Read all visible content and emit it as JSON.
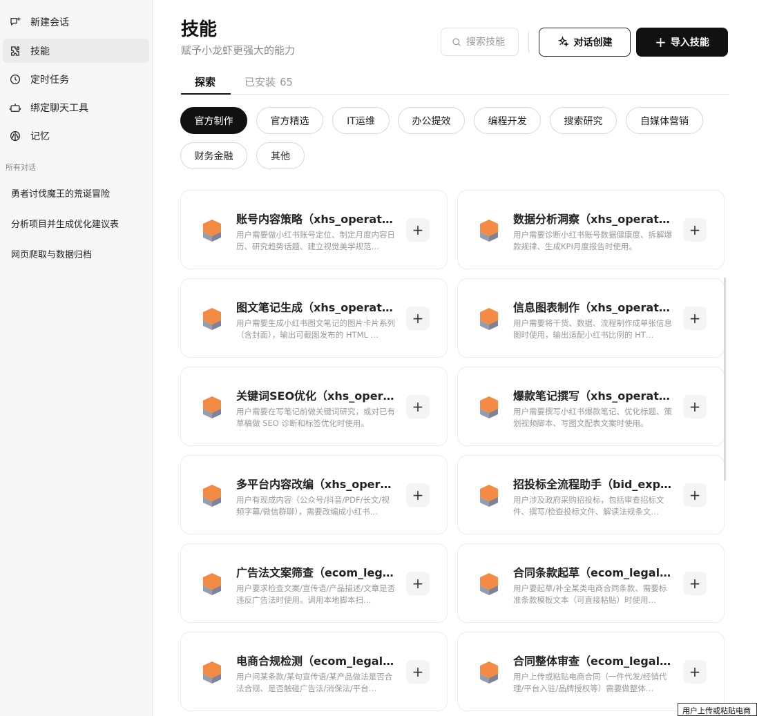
{
  "sidebar": {
    "nav": [
      {
        "label": "新建会话",
        "icon": "new-chat-icon"
      },
      {
        "label": "技能",
        "icon": "puzzle-icon"
      },
      {
        "label": "定时任务",
        "icon": "clock-icon"
      },
      {
        "label": "绑定聊天工具",
        "icon": "bot-icon"
      },
      {
        "label": "记忆",
        "icon": "brain-icon"
      }
    ],
    "section_label": "所有对话",
    "conversations": [
      {
        "label": "勇者讨伐魔王的荒诞冒险"
      },
      {
        "label": "分析项目并生成优化建议表"
      },
      {
        "label": "网页爬取与数据归档"
      }
    ]
  },
  "header": {
    "title": "技能",
    "subtitle": "赋予小龙虾更强大的能力",
    "search_placeholder": "搜索技能",
    "chat_create_label": "对话创建",
    "import_label": "导入技能",
    "import_plus": "+"
  },
  "tabs": {
    "explore": "探索",
    "installed": "已安装",
    "installed_count": "65"
  },
  "categories": [
    {
      "label": "官方制作"
    },
    {
      "label": "官方精选"
    },
    {
      "label": "IT运维"
    },
    {
      "label": "办公提效"
    },
    {
      "label": "编程开发"
    },
    {
      "label": "搜索研究"
    },
    {
      "label": "自媒体营销"
    },
    {
      "label": "财务金融"
    },
    {
      "label": "其他"
    }
  ],
  "skills": [
    {
      "title": "账号内容策略（xhs_operato…",
      "desc": "用户需要做小红书账号定位、制定月度内容日历、研究趋势话题、建立视觉美学规范…"
    },
    {
      "title": "数据分析洞察（xhs_operato…",
      "desc": "用户需要诊断小红书账号数据健康度、拆解爆款规律、生成KPI月度报告时使用。"
    },
    {
      "title": "图文笔记生成（xhs_operato…",
      "desc": "用户需要生成小红书图文笔记的图片卡片系列（含封面），输出可截图发布的 HTML …"
    },
    {
      "title": "信息图表制作（xhs_operato…",
      "desc": "用户需要将干货、数据、流程制作成单张信息图时使用，输出适配小红书比例的 HT…"
    },
    {
      "title": "关键词SEO优化（xhs_opera…",
      "desc": "用户需要在写笔记前做关键词研究，或对已有草稿做 SEO 诊断和标签优化时使用。"
    },
    {
      "title": "爆款笔记撰写（xhs_operato…",
      "desc": "用户需要撰写小红书爆款笔记、优化标题、策划视频脚本、写图文配表文案时使用。"
    },
    {
      "title": "多平台内容改编（xhs_opera…",
      "desc": "用户有现成内容（公众号/抖音/PDF/长文/视频字幕/微信群聊），需要改编成小红书…"
    },
    {
      "title": "招投标全流程助手（bid_exp…",
      "desc": "用户涉及政府采购招投标，包括审查招标文件、撰写/检查投标文件、解读法规条文…"
    },
    {
      "title": "广告法文案筛查（ecom_lega…",
      "desc": "用户要求检查文案/宣传语/产品描述/文章是否违反广告法时使用。调用本地脚本扫…"
    },
    {
      "title": "合同条款起草（ecom_legal_…",
      "desc": "用户要起草/补全某类电商合同条款、需要标准条款模板文本（可直接粘贴）时使用…"
    },
    {
      "title": "电商合规检测（ecom_legal_…",
      "desc": "用户问某条款/某句宣传语/某产品做法是否合法合规、是否触碰广告法/消保法/平台…"
    },
    {
      "title": "合同整体审查（ecom_legal_…",
      "desc": "用户上传或粘贴电商合同（一件代发/经销代理/平台入驻/品牌授权等）需要做整体…"
    }
  ],
  "tooltip": "用户上传或粘贴电商",
  "colors": {
    "accent_dark": "#111111",
    "cube_orange": "#f28c45",
    "cube_gray": "#9a9cab"
  }
}
